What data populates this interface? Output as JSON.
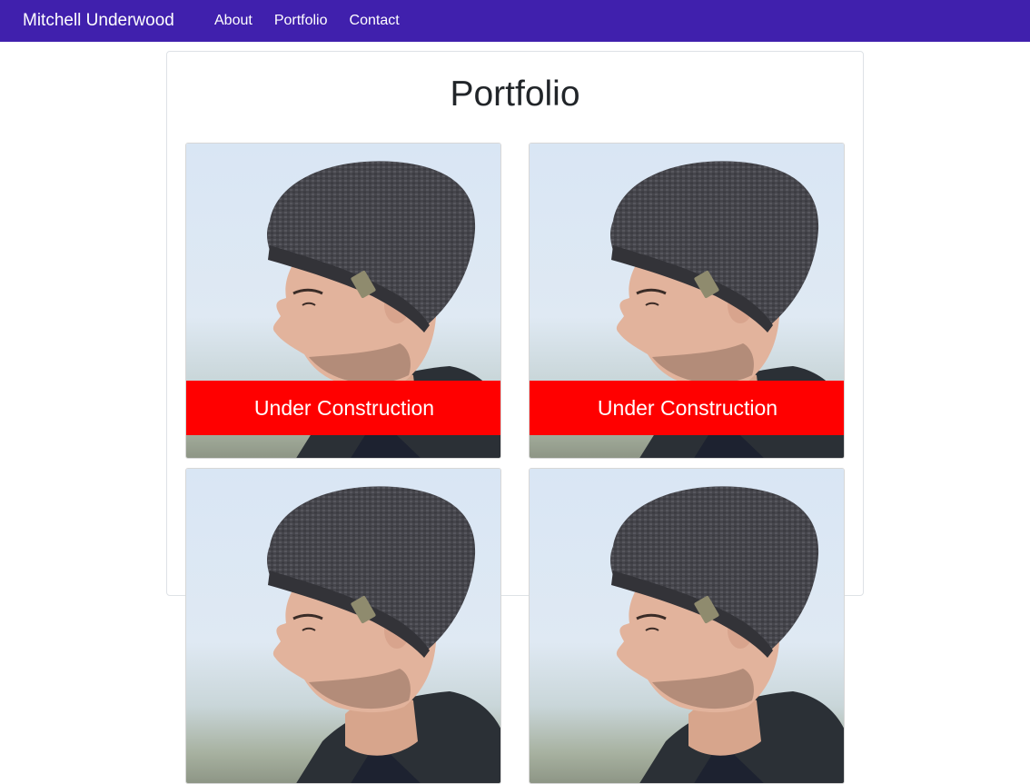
{
  "navbar": {
    "brand": "Mitchell Underwood",
    "links": [
      {
        "label": "About"
      },
      {
        "label": "Portfolio"
      },
      {
        "label": "Contact"
      }
    ],
    "background": "#4020ad"
  },
  "main": {
    "title": "Portfolio",
    "projects": [
      {
        "image": "portrait-photo",
        "status": "Under Construction"
      },
      {
        "image": "portrait-photo",
        "status": "Under Construction"
      },
      {
        "image": "portrait-photo",
        "status": ""
      },
      {
        "image": "portrait-photo",
        "status": ""
      }
    ]
  },
  "colors": {
    "accent": "#4020ad",
    "banner": "#ff0000"
  }
}
